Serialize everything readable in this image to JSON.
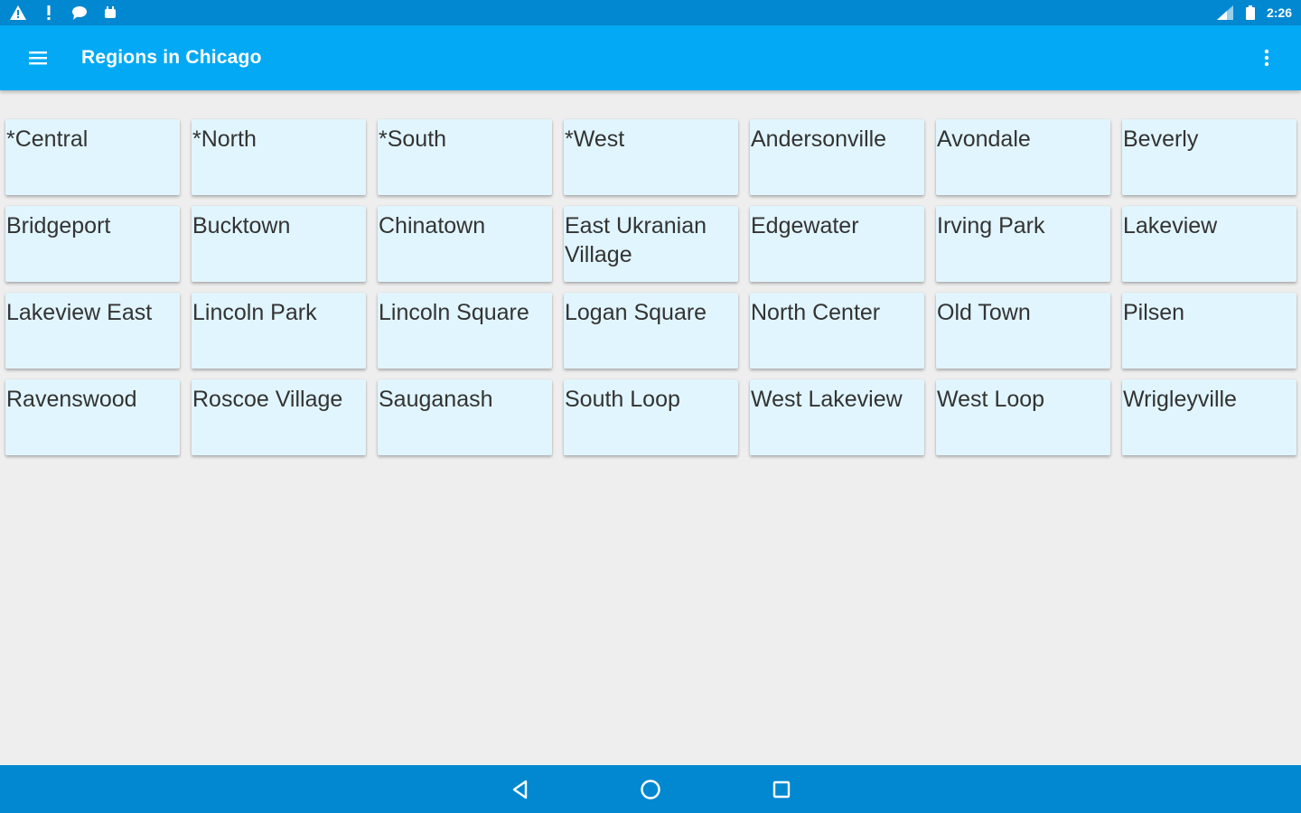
{
  "status_bar": {
    "time": "2:26",
    "left_icons": [
      "warning-icon",
      "alert-icon",
      "chat-icon",
      "android-icon"
    ],
    "right_icons": [
      "signal-icon",
      "battery-icon"
    ]
  },
  "app_bar": {
    "title": "Regions in Chicago",
    "menu_icon": "hamburger-menu-icon",
    "overflow_icon": "more-vertical-icon"
  },
  "regions": [
    "*Central",
    "*North",
    "*South",
    "*West",
    "Andersonville",
    "Avondale",
    "Beverly",
    "Bridgeport",
    "Bucktown",
    "Chinatown",
    "East Ukranian Village",
    "Edgewater",
    "Irving Park",
    "Lakeview",
    "Lakeview East",
    "Lincoln Park",
    "Lincoln Square",
    "Logan Square",
    "North Center",
    "Old Town",
    "Pilsen",
    "Ravenswood",
    "Roscoe Village",
    "Sauganash",
    "South Loop",
    "West Lakeview",
    "West Loop",
    "Wrigleyville"
  ],
  "nav_bar": {
    "icons": [
      "back-icon",
      "home-icon",
      "recents-icon"
    ]
  },
  "colors": {
    "status_bar": "#0288d1",
    "app_bar": "#03a9f4",
    "tile_background": "#e1f5fe",
    "page_background": "#eeeeee"
  }
}
